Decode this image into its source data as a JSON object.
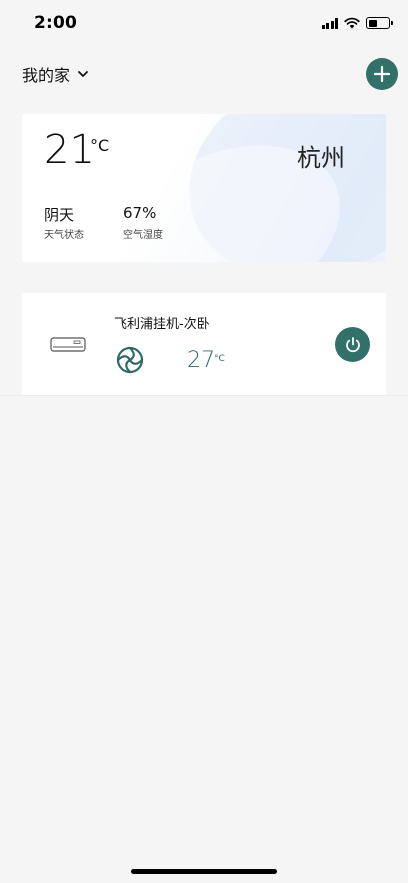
{
  "status_bar": {
    "time": "2:00",
    "icons": [
      "cellular-signal-icon",
      "wifi-icon",
      "battery-icon"
    ],
    "battery_level": 0.45
  },
  "header": {
    "home_name": "我的家",
    "dropdown_icon": "chevron-down-icon",
    "add_icon": "plus-icon"
  },
  "weather": {
    "temperature": "21",
    "unit": "°C",
    "city": "杭州",
    "condition_value": "阴天",
    "condition_label": "天气状态",
    "humidity_value": "67%",
    "humidity_label": "空气湿度"
  },
  "device": {
    "name": "飞利浦挂机-次卧",
    "type_icon": "air-conditioner-icon",
    "mode_icon": "fan-mode-icon",
    "temperature": "27",
    "unit": "°C",
    "power_icon": "power-icon"
  },
  "colors": {
    "accent": "#33706a",
    "background": "#f5f5f5",
    "card": "#ffffff"
  }
}
